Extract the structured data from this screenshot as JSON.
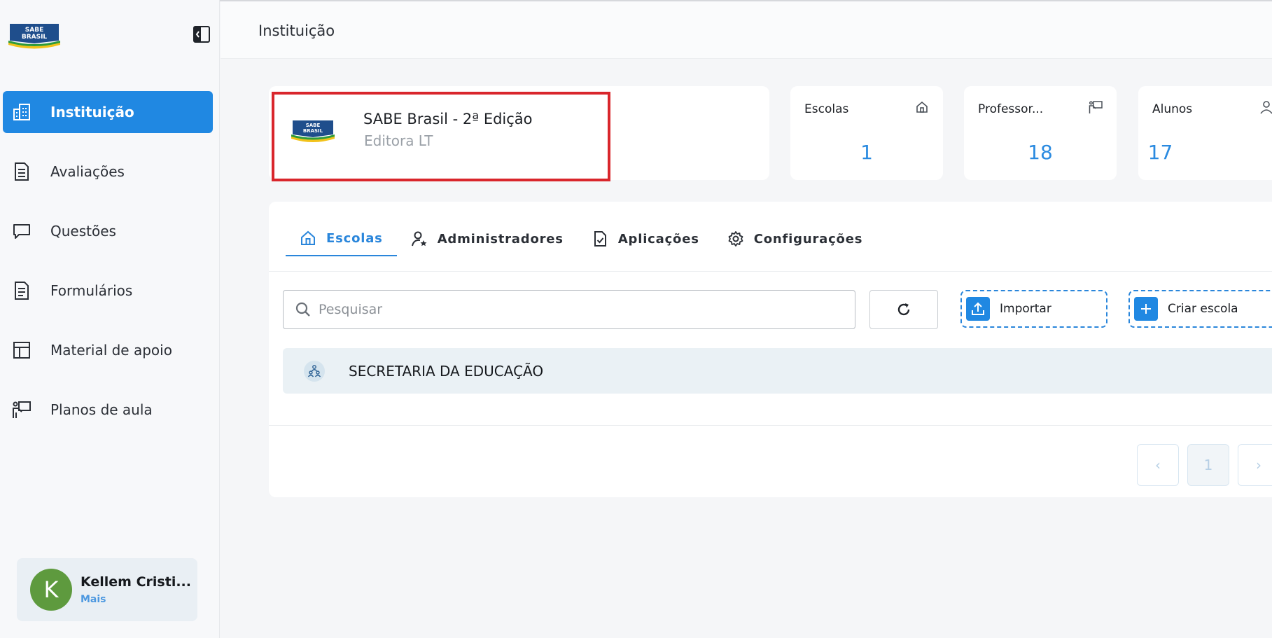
{
  "sidebar": {
    "logo_text_1": "SABE",
    "logo_text_2": "BRASIL",
    "collapse_icon": "sidebar-collapse-icon",
    "items": [
      {
        "label": "Instituição",
        "icon": "building-icon",
        "active": true
      },
      {
        "label": "Avaliações",
        "icon": "document-icon",
        "active": false
      },
      {
        "label": "Questões",
        "icon": "chat-icon",
        "active": false
      },
      {
        "label": "Formulários",
        "icon": "form-icon",
        "active": false
      },
      {
        "label": "Material de apoio",
        "icon": "layout-icon",
        "active": false
      },
      {
        "label": "Planos de aula",
        "icon": "teacher-board-icon",
        "active": false
      }
    ],
    "user": {
      "initial": "K",
      "name": "Kellem Cristi...",
      "more": "Mais"
    }
  },
  "header": {
    "title": "Instituição"
  },
  "institution": {
    "name": "SABE Brasil - 2ª Edição",
    "subtitle": "Editora LT"
  },
  "stats": [
    {
      "label": "Escolas",
      "value": "1",
      "icon": "home-icon"
    },
    {
      "label": "Professor...",
      "value": "18",
      "icon": "teacher-board-icon"
    },
    {
      "label": "Alunos",
      "value": "17",
      "icon": "user-icon"
    }
  ],
  "tabs": [
    {
      "label": "Escolas",
      "icon": "home-icon",
      "active": true
    },
    {
      "label": "Administradores",
      "icon": "user-star-icon",
      "active": false
    },
    {
      "label": "Aplicações",
      "icon": "file-check-icon",
      "active": false
    },
    {
      "label": "Configurações",
      "icon": "gear-icon",
      "active": false
    }
  ],
  "toolbar": {
    "search_placeholder": "Pesquisar",
    "import_label": "Importar",
    "create_label": "Criar escola"
  },
  "list": [
    {
      "label": "SECRETARIA DA EDUCAÇÃO",
      "icon": "people-group-icon"
    }
  ],
  "pagination": {
    "prev": "‹",
    "current": "1",
    "next": "›"
  },
  "colors": {
    "accent": "#2088e2",
    "highlight": "#d9262c",
    "avatar": "#5e9a3e"
  }
}
